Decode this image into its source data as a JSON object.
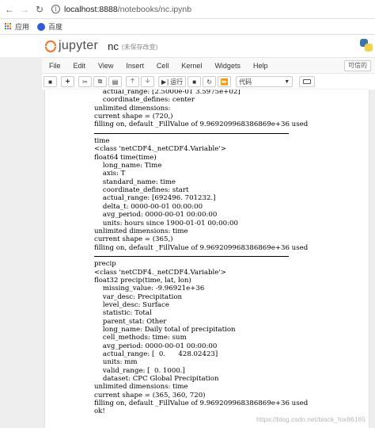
{
  "browser": {
    "url_host": "localhost:8888",
    "url_path": "/notebooks/nc.ipynb",
    "bookmarks": [
      {
        "label": "应用",
        "icon": "apps-grid-icon"
      },
      {
        "label": "百度",
        "icon": "baidu-paw-icon"
      }
    ]
  },
  "header": {
    "logo_text": "jupyter",
    "notebook_name": "nc",
    "save_status": "(未保存改变)"
  },
  "menu": {
    "items": [
      "File",
      "Edit",
      "View",
      "Insert",
      "Cell",
      "Kernel",
      "Widgets",
      "Help"
    ],
    "trusted": "可信的"
  },
  "toolbar": {
    "run_label": "运行",
    "cell_type": "代码",
    "buttons": [
      "save-icon",
      "add-cell-icon",
      "cut-icon",
      "copy-icon",
      "paste-icon",
      "move-up-icon",
      "move-down-icon",
      "run-icon",
      "interrupt-icon",
      "restart-icon",
      "restart-run-all-icon",
      "keyboard-icon"
    ]
  },
  "output": {
    "lines": [
      "    actual_range: [2.5000e-01 3.5975e+02]",
      "    coordinate_defines: center",
      "unlimited dimensions:",
      "current shape = (720,)",
      "filling on, default _FillValue of 9.969209968386869e+36 used",
      "---",
      "time",
      "<class 'netCDF4._netCDF4.Variable'>",
      "float64 time(time)",
      "    long_name: Time",
      "    axis: T",
      "    standard_name: time",
      "    coordinate_defines: start",
      "    actual_range: [692496. 701232.]",
      "    delta_t: 0000-00-01 00:00:00",
      "    avg_period: 0000-00-01 00:00:00",
      "    units: hours since 1900-01-01 00:00:00",
      "unlimited dimensions: time",
      "current shape = (365,)",
      "filling on, default _FillValue of 9.969209968386869e+36 used",
      "---",
      "precip",
      "<class 'netCDF4._netCDF4.Variable'>",
      "float32 precip(time, lat, lon)",
      "    missing_value: -9.96921e+36",
      "    var_desc: Precipitation",
      "    level_desc: Surface",
      "    statistic: Total",
      "    parent_stat: Other",
      "    long_name: Daily total of precipitation",
      "    cell_methods: time: sum",
      "    avg_period: 0000-00-01 00:00:00",
      "    actual_range: [  0.      428.02423]",
      "    units: mm",
      "    valid_range: [  0. 1000.]",
      "    dataset: CPC Global Precipitation",
      "unlimited dimensions: time",
      "current shape = (365, 360, 720)",
      "filling on, default _FillValue of 9.969209968386869e+36 used",
      "ok!"
    ]
  },
  "watermark": "https://blog.csdn.net/black_fox86165"
}
